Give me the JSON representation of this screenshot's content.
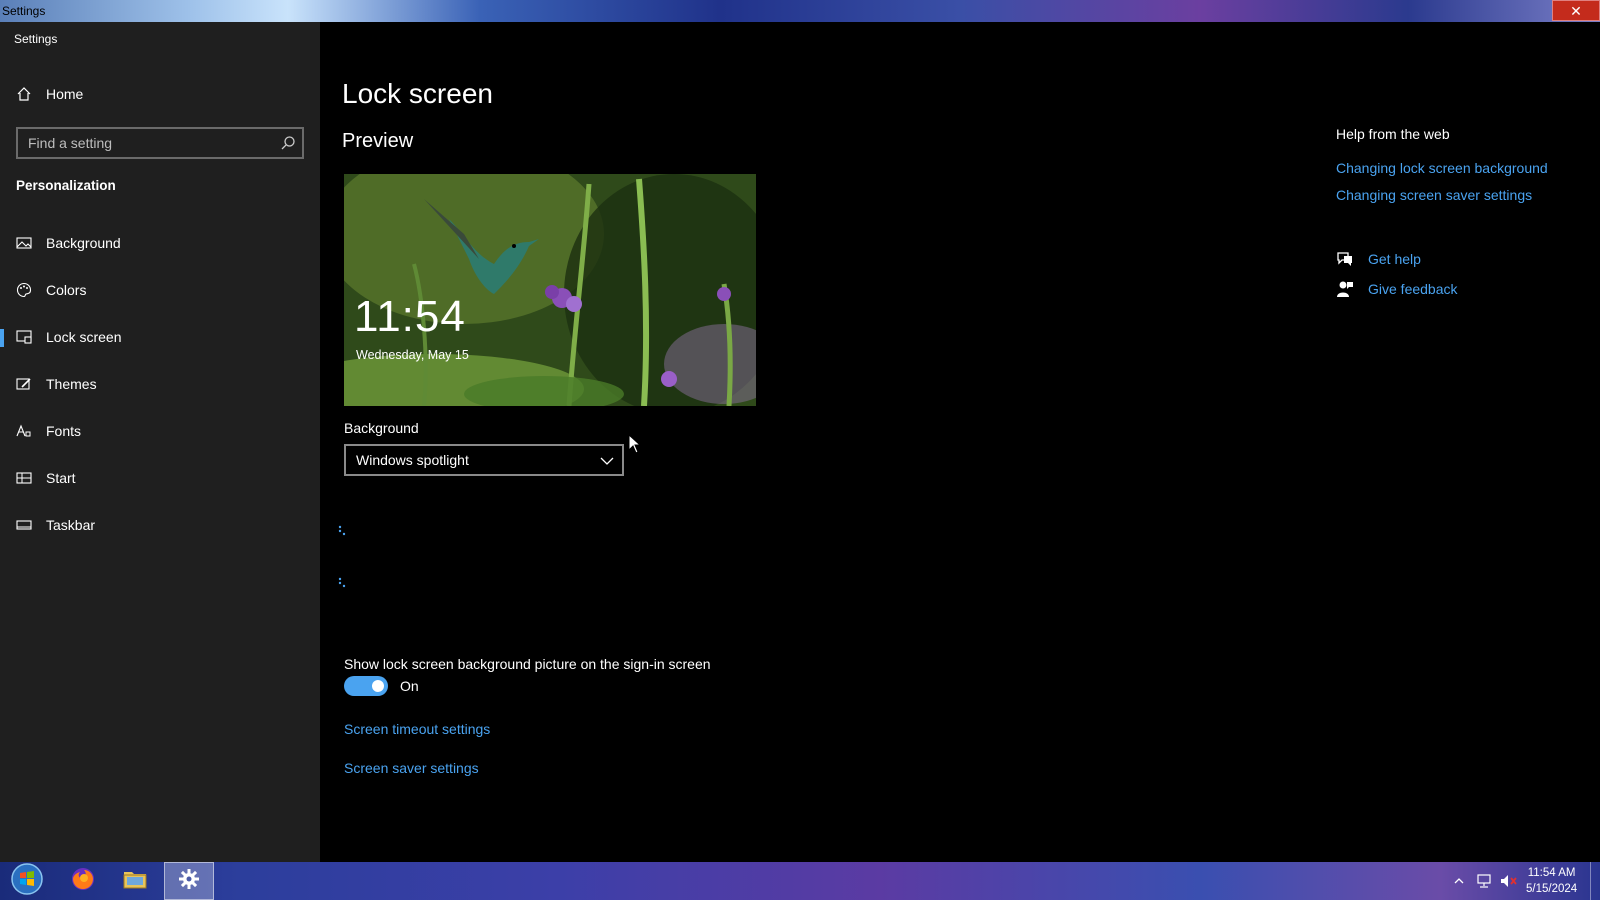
{
  "window": {
    "title": "Settings",
    "close_glyph": "✕"
  },
  "sidebar": {
    "app_title": "Settings",
    "home_label": "Home",
    "search_placeholder": "Find a setting",
    "section": "Personalization",
    "items": [
      {
        "label": "Background",
        "icon": "picture-icon"
      },
      {
        "label": "Colors",
        "icon": "palette-icon"
      },
      {
        "label": "Lock screen",
        "icon": "lock-screen-icon",
        "selected": true
      },
      {
        "label": "Themes",
        "icon": "brush-icon"
      },
      {
        "label": "Fonts",
        "icon": "font-icon"
      },
      {
        "label": "Start",
        "icon": "start-grid-icon"
      },
      {
        "label": "Taskbar",
        "icon": "taskbar-icon"
      }
    ]
  },
  "main": {
    "title": "Lock screen",
    "preview_heading": "Preview",
    "preview": {
      "time": "11:54",
      "date": "Wednesday, May 15"
    },
    "background_label": "Background",
    "background_value": "Windows spotlight",
    "signin_label": "Show lock screen background picture on the sign-in screen",
    "toggle_state": "On",
    "toggle_on": true,
    "link_timeout": "Screen timeout settings",
    "link_saver": "Screen saver settings"
  },
  "help": {
    "title": "Help from the web",
    "links": [
      "Changing lock screen background",
      "Changing screen saver settings"
    ],
    "get_help": "Get help",
    "give_feedback": "Give feedback"
  },
  "taskbar": {
    "time": "11:54 AM",
    "date": "5/15/2024",
    "apps": [
      "start-orb-icon",
      "firefox-icon",
      "file-explorer-icon",
      "settings-gear-icon"
    ]
  },
  "colors": {
    "accent": "#4aa3f0",
    "sidebar_bg": "#1f1f1f",
    "main_bg": "#000000"
  }
}
